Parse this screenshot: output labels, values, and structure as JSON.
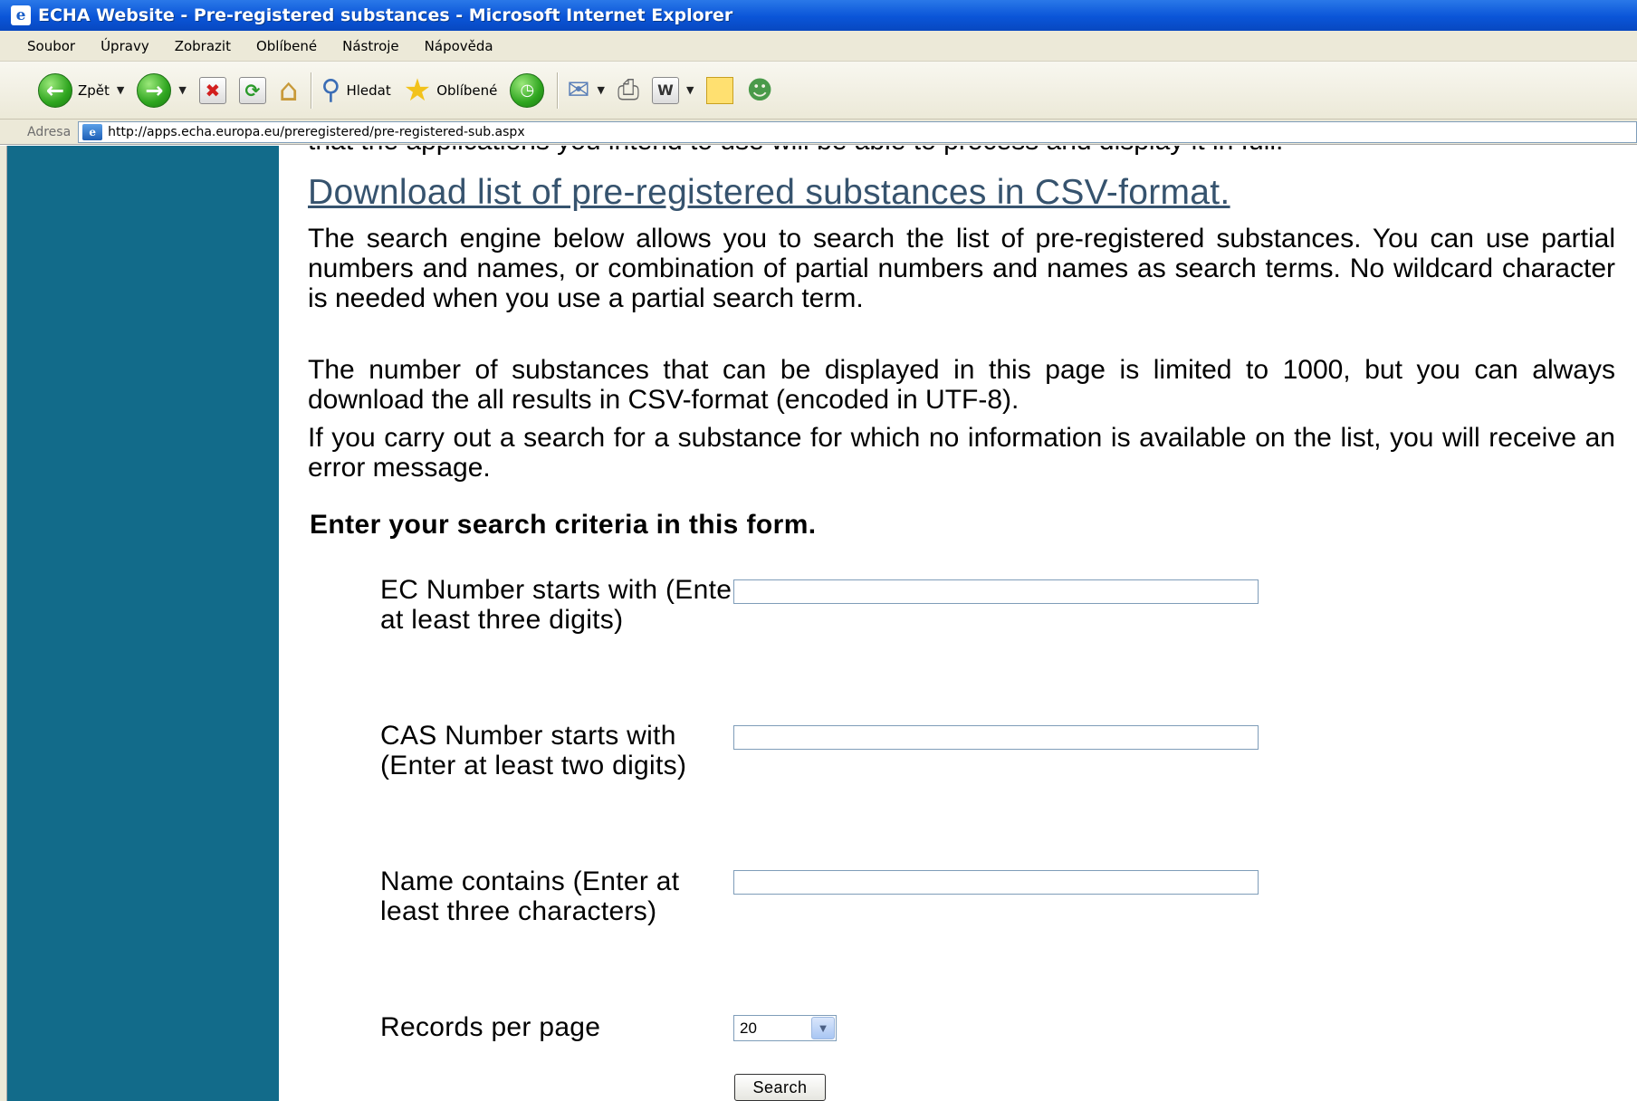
{
  "window": {
    "title": "ECHA Website - Pre-registered substances - Microsoft Internet Explorer",
    "app_icon": "ie-page-icon"
  },
  "menubar": {
    "items": [
      "Soubor",
      "Úpravy",
      "Zobrazit",
      "Oblíbené",
      "Nástroje",
      "Nápověda"
    ]
  },
  "toolbar": {
    "back_label": "Zpět",
    "search_label": "Hledat",
    "favorites_label": "Oblíbené",
    "icons": [
      "back-arrow-icon",
      "forward-arrow-icon",
      "stop-icon",
      "refresh-icon",
      "home-icon",
      "search-icon",
      "favorites-star-icon",
      "history-icon",
      "mail-icon",
      "print-icon",
      "word-icon",
      "note-icon",
      "messenger-icon"
    ]
  },
  "address": {
    "label": "Adresa",
    "url": "http://apps.echa.europa.eu/preregistered/pre-registered-sub.aspx"
  },
  "page": {
    "cutoff_text": "that the applications you intend to use will be able to process and display it in full.",
    "download_link": "Download list of pre-registered substances in CSV-format.",
    "paragraphs": [
      "The search engine below allows you to search the list of pre-registered substances. You can use partial numbers and names, or combination of partial numbers and names as search terms. No wildcard character is needed when you use a partial search term.",
      "The number of substances that can be displayed in this page is limited to 1000, but you can always download the all results in CSV-format (encoded in UTF-8).",
      "If you carry out a search for a substance for which no information is available on the list, you will receive an error message."
    ],
    "form_heading": "Enter your search criteria in this form."
  },
  "form": {
    "ec_label": "EC Number starts with (Enter at least three digits)",
    "ec_value": "",
    "cas_label": "CAS Number starts with (Enter at least two digits)",
    "cas_value": "",
    "name_label": "Name contains (Enter at least three characters)",
    "name_value": "",
    "records_label": "Records per page",
    "records_value": "20",
    "search_button": "Search"
  },
  "colors": {
    "sidebar": "#126b8a",
    "link": "#36536e",
    "titlebar": "#0a55d8"
  }
}
